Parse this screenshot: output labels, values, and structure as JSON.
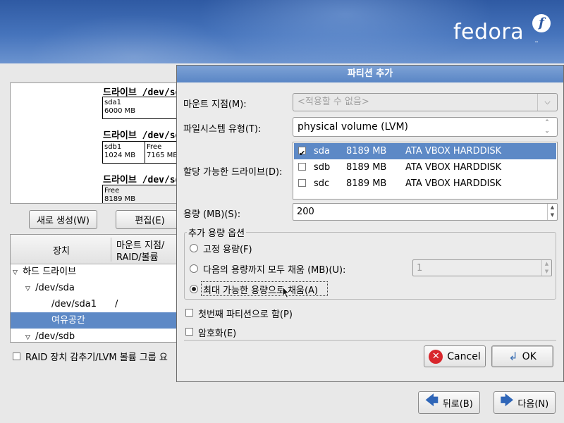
{
  "brand": {
    "logo_text": "fedora",
    "logo_mark": "f",
    "tm": "™"
  },
  "editor": {
    "drives": [
      {
        "title": "드라이브 /dev/sda",
        "segments": [
          {
            "name": "sda1",
            "size": "6000 MB"
          }
        ]
      },
      {
        "title": "드라이브 /dev/sdb",
        "segments": [
          {
            "name": "sdb1",
            "size": "1024 MB"
          },
          {
            "name": "Free",
            "size": "7165 MB"
          }
        ]
      },
      {
        "title": "드라이브 /dev/sdc",
        "segments": [
          {
            "name": "Free",
            "size": "8189 MB"
          }
        ]
      }
    ],
    "buttons": {
      "create": "새로 생성(W)",
      "edit": "편집(E)"
    },
    "tree_headers": {
      "device": "장치",
      "mount": "마운트 지점/",
      "mount2": "RAID/볼륨"
    },
    "tree_rows": [
      {
        "label": "하드 드라이브",
        "mount": ""
      },
      {
        "label": "/dev/sda",
        "mount": ""
      },
      {
        "label": "/dev/sda1",
        "mount": "/"
      },
      {
        "label": "여유공간",
        "mount": ""
      },
      {
        "label": "/dev/sdb",
        "mount": ""
      }
    ],
    "hide_raid_label": "RAID 장치 감추기/LVM 볼륨 그룹 요"
  },
  "dialog": {
    "title": "파티션 추가",
    "mount_label": "마운트 지점(M):",
    "mount_placeholder": "<적용할 수 없음>",
    "fs_label": "파일시스템 유형(T):",
    "fs_value": "physical volume (LVM)",
    "drives_label": "할당 가능한 드라이브(D):",
    "drives": [
      {
        "name": "sda",
        "size": "8189 MB",
        "model": "ATA VBOX HARDDISK",
        "checked": true
      },
      {
        "name": "sdb",
        "size": "8189 MB",
        "model": "ATA VBOX HARDDISK",
        "checked": false
      },
      {
        "name": "sdc",
        "size": "8189 MB",
        "model": "ATA VBOX HARDDISK",
        "checked": false
      }
    ],
    "size_label": "용량 (MB)(S):",
    "size_value": "200",
    "options_title": "추가 용량 옵션",
    "opt_fixed": "고정 용량(F)",
    "opt_fill_upto": "다음의 용량까지 모두 채움 (MB)(U):",
    "opt_fill_upto_value": "1",
    "opt_fill_max": "최대 가능한 용량으로 채움(A)",
    "selected_option": "fill_max",
    "primary_label": "첫번째 파티션으로 함(P)",
    "encrypt_label": "암호화(E)",
    "cancel": "Cancel",
    "ok": "OK"
  },
  "nav": {
    "back": "뒤로(B)",
    "next": "다음(N)"
  }
}
